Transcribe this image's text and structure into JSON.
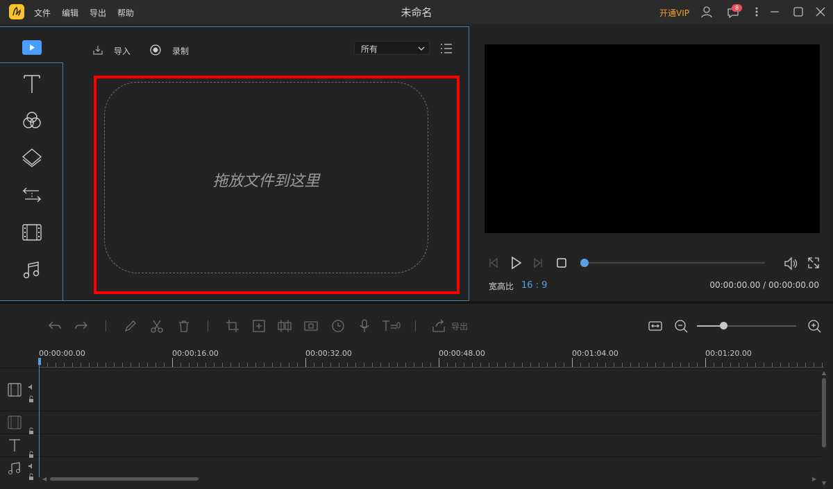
{
  "titlebar": {
    "title": "未命名",
    "menus": [
      "文件",
      "编辑",
      "导出",
      "帮助"
    ],
    "vip_label": "开通VIP",
    "notification_count": "8"
  },
  "media": {
    "import_label": "导入",
    "record_label": "录制",
    "filter_value": "所有",
    "drop_text": "拖放文件到这里"
  },
  "sidebar": {
    "items": [
      "media-icon",
      "text-icon",
      "filter-icon",
      "overlay-icon",
      "transition-icon",
      "film-icon",
      "music-icon"
    ]
  },
  "preview": {
    "ratio_label": "宽高比",
    "ratio_value": "16 : 9",
    "time_readout": "00:00:00.00 / 00:00:00.00",
    "progress": 0
  },
  "timeline": {
    "export_label": "导出",
    "ruler_labels": [
      "00:00:00.00",
      "00:00:16.00",
      "00:00:32.00",
      "00:00:48.00",
      "00:01:04.00",
      "00:01:20.00"
    ]
  },
  "colors": {
    "accent": "#5aa0e0",
    "highlight_border": "#ff0000",
    "vip": "#f0a030"
  }
}
